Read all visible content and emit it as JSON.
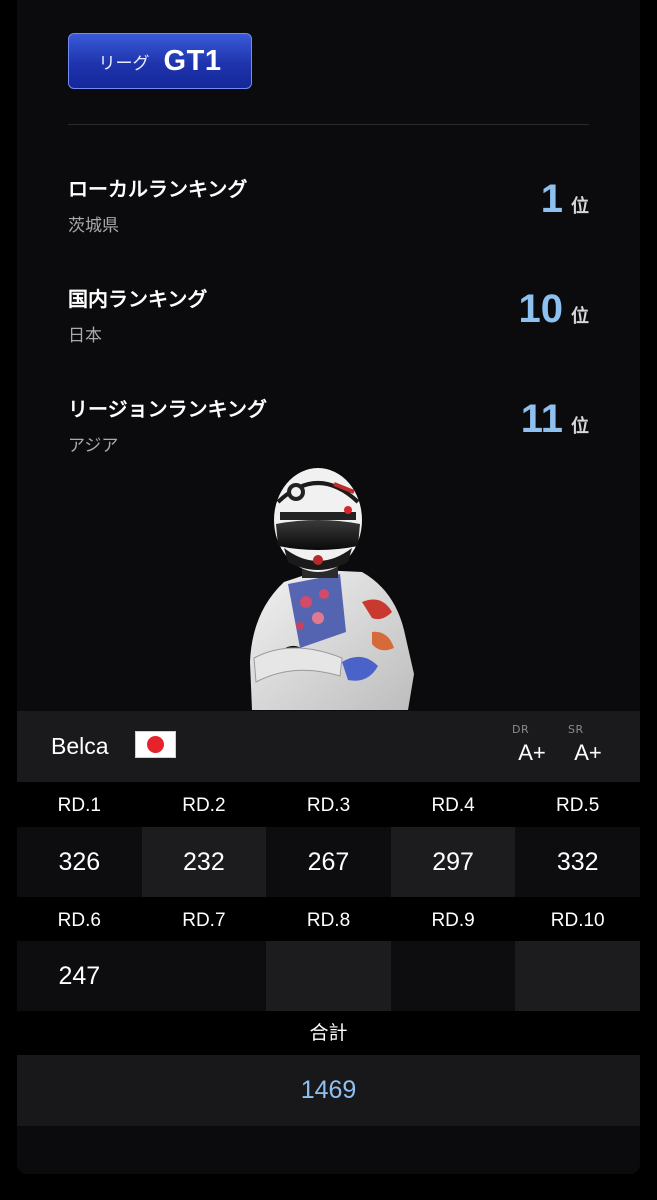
{
  "league": {
    "prefix": "リーグ",
    "name": "GT1"
  },
  "rankings": [
    {
      "title": "ローカルランキング",
      "region": "茨城県",
      "rank": "1",
      "unit": "位"
    },
    {
      "title": "国内ランキング",
      "region": "日本",
      "rank": "10",
      "unit": "位"
    },
    {
      "title": "リージョンランキング",
      "region": "アジア",
      "rank": "11",
      "unit": "位"
    }
  ],
  "driver": {
    "name": "Belca",
    "flag_icon": "japan-flag-icon",
    "dr_label": "DR",
    "dr_value": "A+",
    "sr_label": "SR",
    "sr_value": "A+"
  },
  "rounds": {
    "headers_row1": [
      "RD.1",
      "RD.2",
      "RD.3",
      "RD.4",
      "RD.5"
    ],
    "scores_row1": [
      "326",
      "232",
      "267",
      "297",
      "332"
    ],
    "headers_row2": [
      "RD.6",
      "RD.7",
      "RD.8",
      "RD.9",
      "RD.10"
    ],
    "scores_row2": [
      "247",
      "",
      "",
      "",
      ""
    ]
  },
  "total": {
    "label": "合計",
    "value": "1469"
  },
  "colors": {
    "accent_blue": "#8ec1ef",
    "badge_blue": "#1e34ad",
    "flag_red": "#e5232c"
  }
}
